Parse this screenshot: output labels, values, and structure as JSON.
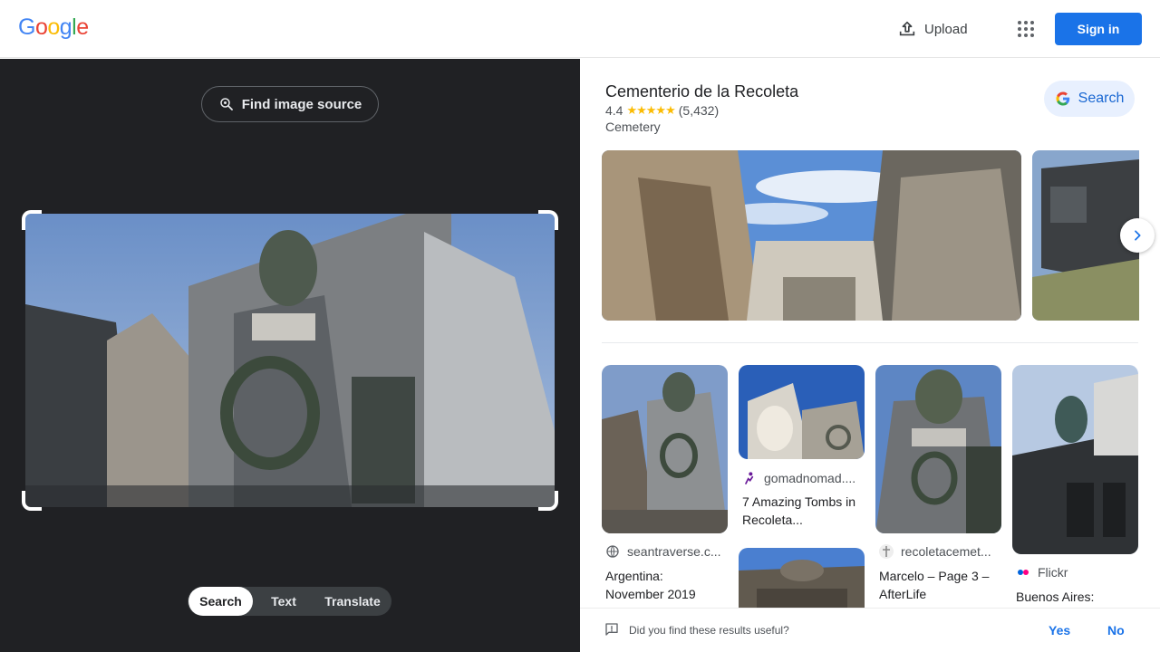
{
  "header": {
    "logo_letters": [
      "G",
      "o",
      "o",
      "g",
      "l",
      "e"
    ],
    "logo_colors": [
      "#4285f4",
      "#ea4335",
      "#fbbc05",
      "#4285f4",
      "#34a853",
      "#ea4335"
    ],
    "upload_label": "Upload",
    "apps_icon": "apps-grid-icon",
    "signin_label": "Sign in"
  },
  "left_panel": {
    "find_source_label": "Find image source",
    "tabs": [
      {
        "label": "Search",
        "active": true
      },
      {
        "label": "Text",
        "active": false
      },
      {
        "label": "Translate",
        "active": false
      }
    ]
  },
  "knowledge_panel": {
    "title": "Cementerio de la Recoleta",
    "rating": "4.4",
    "stars": "★★★★★",
    "review_count": "(5,432)",
    "category": "Cemetery",
    "search_label": "Search"
  },
  "results": [
    {
      "source": "seantraverse.c...",
      "title": "Argentina: November 2019",
      "icon": "globe-icon"
    },
    {
      "source": "gomadnomad....",
      "title": "7 Amazing Tombs in Recoleta...",
      "icon": "gomadnomad-favicon"
    },
    {
      "source": "recoletacemet...",
      "title": "Marcelo – Page 3 – AfterLife",
      "icon": "recoleta-favicon"
    },
    {
      "source": "Flickr",
      "title": "Buenos Aires:",
      "icon": "flickr-icon"
    }
  ],
  "feedback": {
    "question": "Did you find these results useful?",
    "yes_label": "Yes",
    "no_label": "No"
  },
  "colors": {
    "accent_blue": "#1a73e8",
    "dark_panel": "#202124",
    "star_yellow": "#fbbc04"
  }
}
